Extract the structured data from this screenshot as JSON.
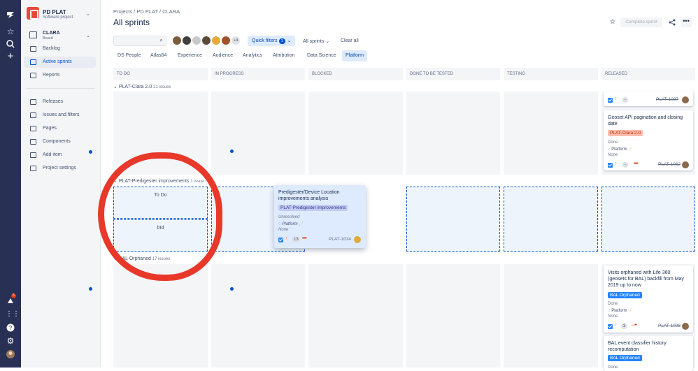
{
  "project": {
    "name": "PD PLAT",
    "type": "Software project"
  },
  "board": {
    "name": "CLARA",
    "sub": "Board"
  },
  "nav": [
    {
      "label": "Backlog"
    },
    {
      "label": "Active sprints"
    },
    {
      "label": "Reports"
    },
    {
      "label": "Releases"
    },
    {
      "label": "Issues and filters"
    },
    {
      "label": "Pages"
    },
    {
      "label": "Components"
    },
    {
      "label": "Add item"
    },
    {
      "label": "Project settings"
    }
  ],
  "notif_count": "5",
  "breadcrumb": "Projects  /  PD PLAT  /  CLARA",
  "title": "All sprints",
  "complete_sprint": "Complete sprint",
  "more_avatars": "+4",
  "quick_filters": "Quick filters",
  "quick_filters_count": "1",
  "all_sprints": "All sprints",
  "clear_all": "Clear all",
  "tabs": [
    "DS People",
    "Atlas84",
    "Experience",
    "Audience",
    "Analytics",
    "Attribution",
    "Data Science",
    "Platform"
  ],
  "columns": [
    "TO DO",
    "IN PROGRESS",
    "BLOCKED",
    "DONE TO BE TESTED",
    "TESTING",
    "RELEASED"
  ],
  "swimlanes": [
    {
      "name": "PLAT-Clara 2.0",
      "count": "21 issues"
    },
    {
      "name": "PLAT-Predigester improvements",
      "count": "1 issue"
    },
    {
      "name": "BAL Orphaned",
      "count": "17 issues"
    }
  ],
  "dropzones": {
    "todo": "To Do",
    "btd": "btd"
  },
  "cards": {
    "c1087": {
      "pill": "-",
      "key": "PLAT-1087"
    },
    "c1062": {
      "title": "Geoset API pagination and closing date",
      "epic": "PLAT-Clara 2.0",
      "status": "Done",
      "component": "Platform",
      "assignee": "None",
      "pill": "-",
      "key": "PLAT-1062"
    },
    "c1014": {
      "title": "Predigester/Device Location improvements analysis",
      "epic": "PLAT-Predigester improvements",
      "status": "Unresolved",
      "component": "Platform",
      "assignee": "None",
      "points": "13",
      "key": "PLAT-1014"
    },
    "c1008": {
      "title": "Visits orphaned with Life 360 (geosets for BAL) backfill from May 2019 up to now",
      "epic": "BAL Orphaned",
      "status": "Done",
      "component": "Platform",
      "assignee": "None",
      "points": "3",
      "key": "PLAT-1008"
    },
    "c_bal": {
      "title": "BAL event classifier history recomputation",
      "epic": "BAL Orphaned",
      "status": "Done"
    }
  }
}
